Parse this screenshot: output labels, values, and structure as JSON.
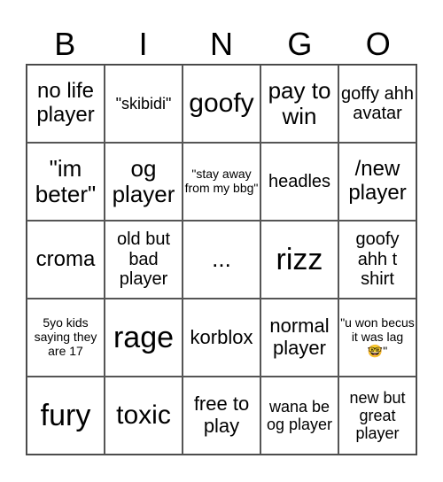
{
  "header": {
    "letters": [
      "B",
      "I",
      "N",
      "G",
      "O"
    ]
  },
  "cells": [
    [
      "no life player",
      "\"skibidi\"",
      "goofy",
      "pay to win",
      "goffy ahh avatar"
    ],
    [
      "\"im beter\"",
      "og player",
      "\"stay away from my bbg\"",
      "headles",
      "/new player"
    ],
    [
      "croma",
      "old but bad player",
      "...",
      "rizz",
      "goofy ahh t shirt"
    ],
    [
      "5yo kids saying they are 17",
      "rage",
      "korblox",
      "normal player",
      "\"u won becus it was lag 🤓\""
    ],
    [
      "fury",
      "toxic",
      "free to play",
      "wana be og player",
      "new but great player"
    ]
  ]
}
